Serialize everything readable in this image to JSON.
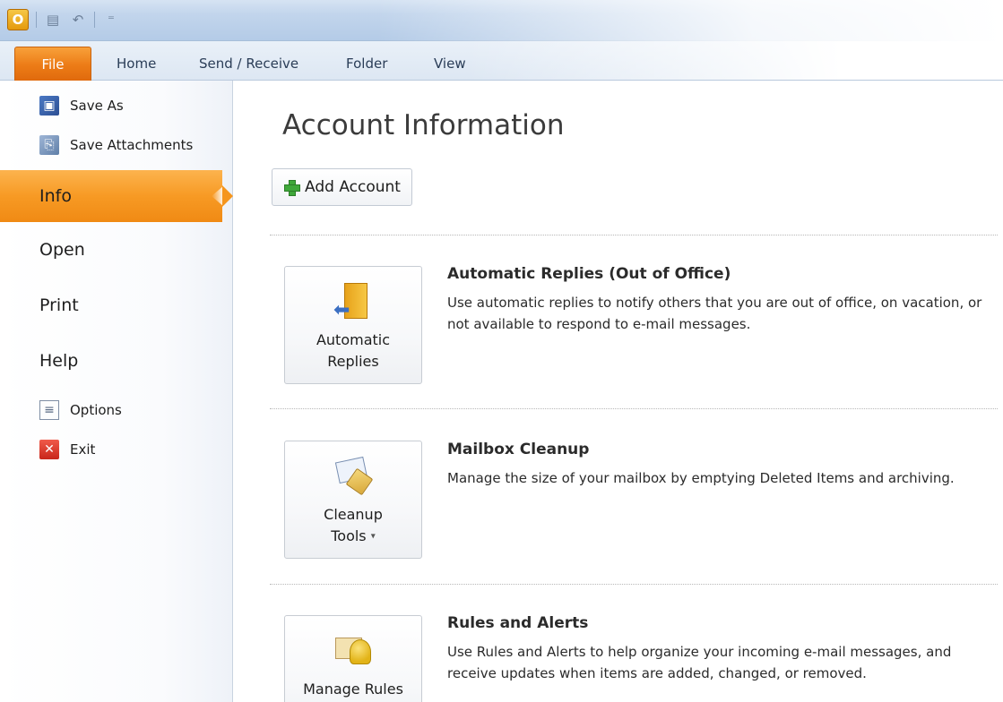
{
  "quick_access": {
    "app_icon_letter": "O",
    "icons": [
      "outlook-icon",
      "send-receive-icon",
      "undo-icon",
      "customize-qat-icon"
    ]
  },
  "ribbon": {
    "tabs": [
      {
        "label": "File",
        "active": true
      },
      {
        "label": "Home"
      },
      {
        "label": "Send / Receive"
      },
      {
        "label": "Folder"
      },
      {
        "label": "View"
      }
    ]
  },
  "sidebar": {
    "commands_top": [
      {
        "label": "Save As",
        "icon": "save-as-icon"
      },
      {
        "label": "Save Attachments",
        "icon": "save-attachments-icon"
      }
    ],
    "tabs": [
      {
        "label": "Info",
        "selected": true
      },
      {
        "label": "Open"
      },
      {
        "label": "Print"
      },
      {
        "label": "Help"
      }
    ],
    "commands_bottom": [
      {
        "label": "Options",
        "icon": "options-icon"
      },
      {
        "label": "Exit",
        "icon": "exit-icon"
      }
    ]
  },
  "main": {
    "title": "Account Information",
    "add_account_label": "Add Account",
    "sections": [
      {
        "button_label_lines": [
          "Automatic",
          "Replies"
        ],
        "title": "Automatic Replies (Out of Office)",
        "description": "Use automatic replies to notify others that you are out of office, on vacation, or not available to respond to e-mail messages.",
        "icon": "automatic-replies-icon"
      },
      {
        "button_label_lines": [
          "Cleanup",
          "Tools"
        ],
        "has_dropdown": true,
        "title": "Mailbox Cleanup",
        "description": "Manage the size of your mailbox by emptying Deleted Items and archiving.",
        "icon": "cleanup-tools-icon"
      },
      {
        "button_label_lines": [
          "Manage Rules"
        ],
        "title": "Rules and Alerts",
        "description": "Use Rules and Alerts to help organize your incoming e-mail messages, and receive updates when items are added, changed, or removed.",
        "icon": "manage-rules-icon"
      }
    ]
  },
  "colors": {
    "file_tab": "#ec7b16",
    "selected_tab": "#f79a24",
    "ribbon_bg": "#dde7f3"
  }
}
